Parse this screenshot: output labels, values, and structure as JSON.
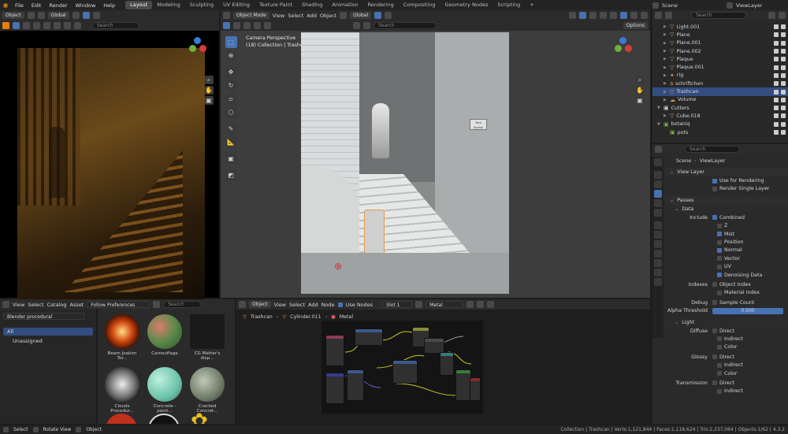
{
  "topbar": {
    "menus": [
      "File",
      "Edit",
      "Render",
      "Window",
      "Help"
    ],
    "workspaces": [
      "Layout",
      "Modeling",
      "Sculpting",
      "UV Editing",
      "Texture Paint",
      "Shading",
      "Animation",
      "Rendering",
      "Compositing",
      "Geometry Nodes",
      "Scripting"
    ],
    "plus": "+",
    "scene_label": "Scene",
    "viewlayer_label": "ViewLayer"
  },
  "left_view": {
    "mode_label": "Object",
    "orient_label": "Global",
    "search_placeholder": "Search"
  },
  "viewport": {
    "mode_label": "Object Mode",
    "menus": [
      "View",
      "Select",
      "Add",
      "Object"
    ],
    "orient_label": "Global",
    "options_label": "Options",
    "search_placeholder": "Search",
    "camera_label": "Camera Perspective",
    "collection_label": "(18) Collection | Trashcan",
    "sign_text": "Tech Access"
  },
  "outliner": {
    "search_placeholder": "Search",
    "items": [
      {
        "name": "Light.001",
        "sel": false
      },
      {
        "name": "Plane",
        "sel": false
      },
      {
        "name": "Plane.001",
        "sel": false
      },
      {
        "name": "Plane.002",
        "sel": false
      },
      {
        "name": "Plaque",
        "sel": false
      },
      {
        "name": "Plaque.001",
        "sel": false
      },
      {
        "name": "rig",
        "sel": false
      },
      {
        "name": "schriftchen",
        "sel": false
      },
      {
        "name": "Trashcan",
        "sel": true
      },
      {
        "name": "Volume",
        "sel": false
      },
      {
        "name": "Cutters",
        "sel": false
      },
      {
        "name": "Cube.018",
        "sel": false
      },
      {
        "name": "botaniq",
        "sel": false
      },
      {
        "name": "pots",
        "sel": false
      }
    ]
  },
  "properties": {
    "search_placeholder": "Search",
    "breadcrumb": [
      "Scene",
      "ViewLayer"
    ],
    "view_layer_header": "View Layer",
    "use_for_rendering": "Use for Rendering",
    "render_single_layer": "Render Single Layer",
    "passes_header": "Passes",
    "data_header": "Data",
    "include_label": "Include",
    "data_passes": [
      {
        "label": "Combined",
        "on": true
      },
      {
        "label": "Z",
        "on": false
      },
      {
        "label": "Mist",
        "on": true
      },
      {
        "label": "Position",
        "on": false
      },
      {
        "label": "Normal",
        "on": true
      },
      {
        "label": "Vector",
        "on": false
      },
      {
        "label": "UV",
        "on": false
      },
      {
        "label": "Denoising Data",
        "on": true
      }
    ],
    "indexes_label": "Indexes",
    "object_index": "Object Index",
    "material_index": "Material Index",
    "debug_label": "Debug",
    "sample_count": "Sample Count",
    "alpha_threshold_label": "Alpha Threshold",
    "alpha_threshold_value": "0.500",
    "light_header": "Light",
    "diffuse_label": "Diffuse",
    "glossy_label": "Glossy",
    "transmission_label": "Transmission",
    "light_opts": [
      "Direct",
      "Indirect",
      "Color"
    ]
  },
  "asset_browser": {
    "menus": [
      "View",
      "Select",
      "Catalog",
      "Asset"
    ],
    "follow_prefs": "Follow Preferences",
    "library": "Blender procedural",
    "catalogs": [
      "All",
      "Unassigned"
    ],
    "search_placeholder": "Search",
    "assets": [
      "Beam Joakim Tor...",
      "Camouflage",
      "CG Matter's disp...",
      "Clouds Procedur...",
      "Concrete - paint...",
      "Cracked Concret..."
    ]
  },
  "node_editor": {
    "object_label": "Object",
    "menus": [
      "View",
      "Select",
      "Add",
      "Node"
    ],
    "use_nodes": "Use Nodes",
    "slot": "Slot 1",
    "material": "Metal",
    "breadcrumb": [
      "Trashcan",
      "Cylinder.011",
      "Metal"
    ]
  },
  "statusbar": {
    "select": "Select",
    "rotate": "Rotate View",
    "object": "Object",
    "stats": "Collection | Trashcan | Verts:1,121,844 | Faces:1,118,624 | Tris:2,237,064 | Objects:1/62 | 4.3.2"
  }
}
